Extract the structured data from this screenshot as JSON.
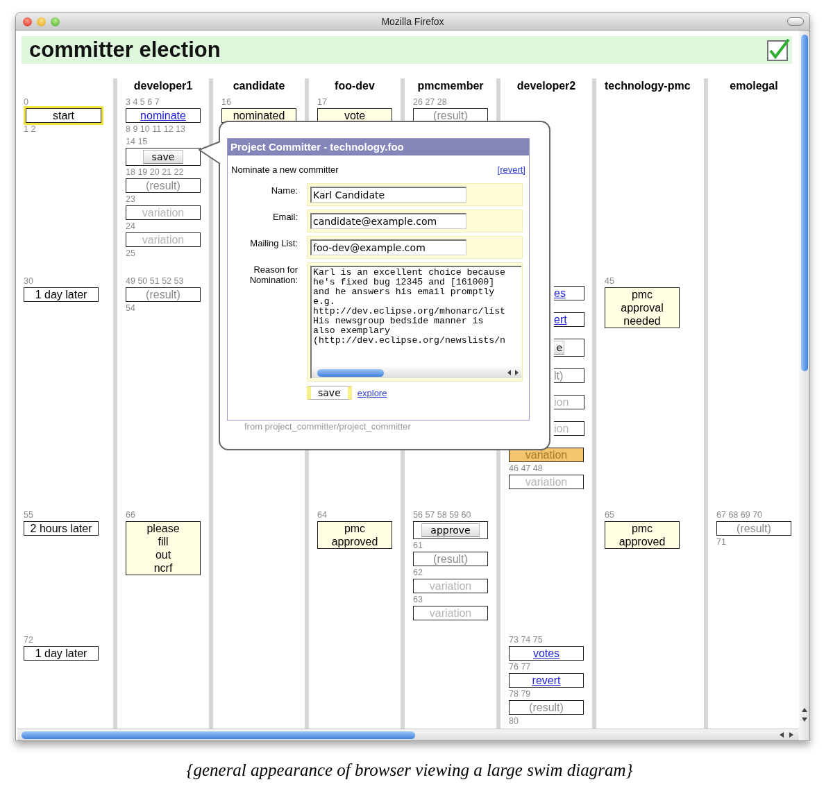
{
  "window": {
    "title": "Mozilla Firefox"
  },
  "page": {
    "title": "committer election"
  },
  "lanes": [
    {
      "row_1": [
        {
          "kind": "nums",
          "text": "0"
        },
        {
          "kind": "action",
          "text": "start",
          "highlighted": true
        },
        {
          "kind": "nums",
          "text": "1 2"
        }
      ],
      "row_2": [
        {
          "kind": "nums",
          "text": "30"
        },
        {
          "kind": "action",
          "text": "1 day later",
          "highlighted": false
        }
      ],
      "row_3": [
        {
          "kind": "nums",
          "text": "55"
        },
        {
          "kind": "action",
          "text": "2 hours later",
          "highlighted": false
        }
      ],
      "row_4": [
        {
          "kind": "nums",
          "text": "72"
        },
        {
          "kind": "action",
          "text": "1 day later",
          "highlighted": false
        }
      ]
    },
    {
      "name": "developer1",
      "row_1": [
        {
          "kind": "nums",
          "text": "3 4 5 6 7"
        },
        {
          "kind": "link",
          "text": "nominate",
          "highlighted": false
        },
        {
          "kind": "nums",
          "text": "8 9 10 11 12 13"
        },
        {
          "kind": "nums",
          "text": "14 15"
        },
        {
          "kind": "button",
          "text": "save",
          "highlighted": false
        },
        {
          "kind": "nums",
          "text": "18 19 20 21 22"
        },
        {
          "kind": "result",
          "text": "(result)",
          "highlighted": false
        },
        {
          "kind": "nums",
          "text": "23"
        },
        {
          "kind": "variation",
          "text": "variation",
          "highlighted": false
        },
        {
          "kind": "nums",
          "text": "24"
        },
        {
          "kind": "variation",
          "text": "variation",
          "highlighted": false
        },
        {
          "kind": "nums",
          "text": "25"
        }
      ],
      "row_2": [
        {
          "kind": "nums",
          "text": "49 50 51 52 53"
        },
        {
          "kind": "result",
          "text": "(result)",
          "highlighted": false
        },
        {
          "kind": "nums",
          "text": "54"
        }
      ],
      "row_3": [
        {
          "kind": "nums",
          "text": "66"
        },
        {
          "kind": "note",
          "text": "please\nfill\nout\nncrf",
          "highlighted": false
        }
      ]
    },
    {
      "name": "candidate",
      "row_1": [
        {
          "kind": "nums",
          "text": "16"
        },
        {
          "kind": "note",
          "text": "nominated",
          "highlighted": false
        }
      ]
    },
    {
      "name": "foo-dev",
      "row_1": [
        {
          "kind": "nums",
          "text": "17"
        },
        {
          "kind": "note",
          "text": "vote",
          "highlighted": false
        }
      ],
      "row_3": [
        {
          "kind": "nums",
          "text": "64"
        },
        {
          "kind": "note",
          "text": "pmc\napproved",
          "highlighted": false
        }
      ]
    },
    {
      "name": "pmcmember",
      "row_1": [
        {
          "kind": "nums",
          "text": "26 27 28"
        },
        {
          "kind": "result",
          "text": "(result)",
          "highlighted": false
        }
      ],
      "row_3": [
        {
          "kind": "nums",
          "text": "56 57 58 59 60"
        },
        {
          "kind": "button",
          "text": "approve",
          "highlighted": false
        },
        {
          "kind": "nums",
          "text": "61"
        },
        {
          "kind": "result",
          "text": "(result)",
          "highlighted": false
        },
        {
          "kind": "nums",
          "text": "62"
        },
        {
          "kind": "variation",
          "text": "variation",
          "highlighted": false
        },
        {
          "kind": "nums",
          "text": "63"
        },
        {
          "kind": "variation",
          "text": "variation",
          "highlighted": false
        }
      ]
    },
    {
      "name": "developer2",
      "row_2": [
        {
          "kind": "link",
          "text": "es",
          "highlighted": false
        },
        {
          "kind": "link",
          "text": "ert",
          "highlighted": false
        },
        {
          "kind": "button",
          "text": "e",
          "highlighted": false
        },
        {
          "kind": "result",
          "text": "lt)",
          "highlighted": false
        },
        {
          "kind": "variation",
          "text": "ion",
          "highlighted": false
        },
        {
          "kind": "variation",
          "text": "ion",
          "highlighted": false
        },
        {
          "kind": "variation",
          "text": "variation",
          "highlighted": true
        },
        {
          "kind": "nums",
          "text": "46 47 48"
        },
        {
          "kind": "variation",
          "text": "variation",
          "highlighted": false
        }
      ],
      "row_4": [
        {
          "kind": "nums",
          "text": "73 74 75"
        },
        {
          "kind": "link",
          "text": "votes",
          "highlighted": false
        },
        {
          "kind": "nums",
          "text": "76 77"
        },
        {
          "kind": "link",
          "text": "revert",
          "highlighted": false
        },
        {
          "kind": "nums",
          "text": "78 79"
        },
        {
          "kind": "result",
          "text": "(result)",
          "highlighted": false
        },
        {
          "kind": "nums",
          "text": "80"
        }
      ]
    },
    {
      "name": "technology-pmc",
      "row_2": [
        {
          "kind": "nums",
          "text": "45"
        },
        {
          "kind": "note",
          "text": "pmc\napproval\nneeded",
          "highlighted": false
        }
      ],
      "row_3": [
        {
          "kind": "nums",
          "text": "65"
        },
        {
          "kind": "note",
          "text": "pmc\napproved",
          "highlighted": false
        }
      ]
    },
    {
      "name": "emolegal",
      "row_3": [
        {
          "kind": "nums",
          "text": "67 68 69 70"
        },
        {
          "kind": "result",
          "text": "(result)",
          "highlighted": false
        },
        {
          "kind": "nums",
          "text": "71"
        }
      ]
    }
  ],
  "popup": {
    "title": "Project Committer - technology.foo",
    "heading": "Nominate a new committer",
    "revert_link": "[revert]",
    "fields": [
      {
        "label": "Name:",
        "value": "Karl Candidate"
      },
      {
        "label": "Email:",
        "value": "candidate@example.com"
      },
      {
        "label": "Mailing List:",
        "value": "foo-dev@example.com"
      }
    ],
    "reason": {
      "label": "Reason for\nNomination:",
      "value": "Karl is an excellent choice because\nhe's fixed bug 12345 and [161000]\nand he answers his email promptly\ne.g.\nhttp://dev.eclipse.org/mhonarc/list\nHis newsgroup bedside manner is\nalso exemplary\n(http://dev.eclipse.org/newslists/n"
    },
    "save_button": "save",
    "explore_link": "explore",
    "source": "from project_committer/project_committer"
  },
  "caption": "{general appearance of browser viewing a large swim diagram}"
}
